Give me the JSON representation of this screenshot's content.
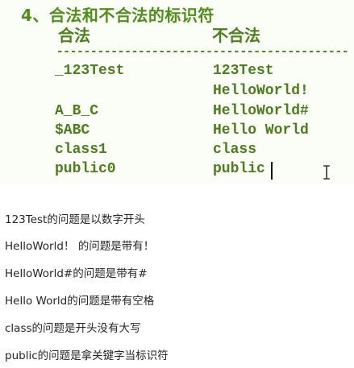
{
  "slide": {
    "title": "4、合法和不合法的标识符",
    "headers": {
      "legal": "合法",
      "illegal": "不合法"
    },
    "divider": "------------------------------------------------------------",
    "legal_items": [
      "_123Test",
      "A_B_C",
      "$ABC",
      "class1",
      "public0"
    ],
    "illegal_items": [
      "123Test",
      "HelloWorld!",
      "HelloWorld#",
      "Hello World",
      "class",
      "public"
    ]
  },
  "explanations": [
    "123Test的问题是以数字开头",
    "HelloWorld！ 的问题是带有！",
    "HelloWorld#的问题是带有#",
    "Hello World的问题是带有空格",
    "class的问题是开头没有大写",
    "public的问题是拿关键字当标识符"
  ],
  "colors": {
    "slide_text": "#4b7f1c",
    "slide_background": "#fbfdf7",
    "body_text": "#262626"
  },
  "icons": {
    "cursor": "text-cursor",
    "pointer": "ibeam-icon"
  }
}
